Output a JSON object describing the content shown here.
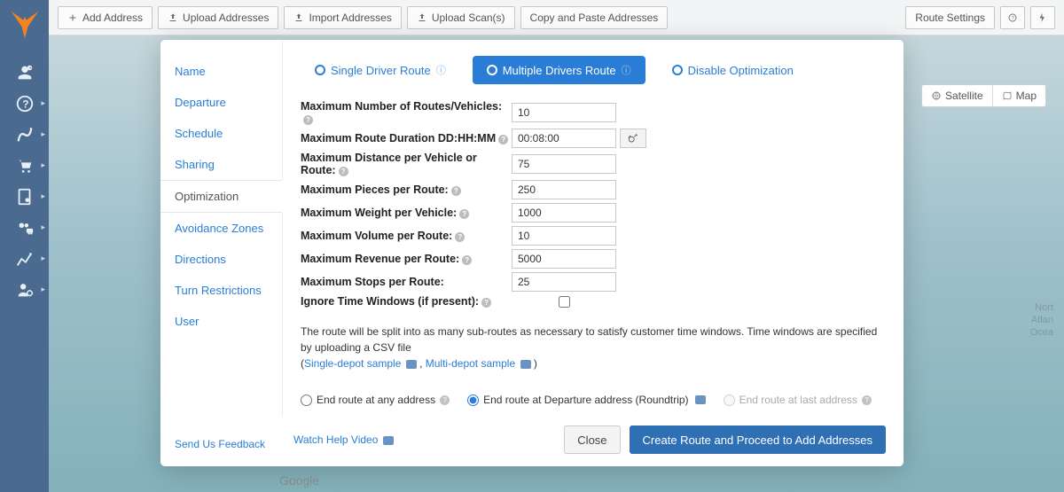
{
  "toolbar": {
    "add_address": "Add Address",
    "upload_addresses": "Upload Addresses",
    "import_addresses": "Import Addresses",
    "upload_scans": "Upload Scan(s)",
    "copy_paste": "Copy and Paste Addresses",
    "route_settings": "Route Settings"
  },
  "map": {
    "satellite": "Satellite",
    "map": "Map",
    "ocean_label": "Nort\nAtlan\nOcea",
    "footer": "Google"
  },
  "modal": {
    "left_tabs": [
      "Name",
      "Departure",
      "Schedule",
      "Sharing",
      "Optimization",
      "Avoidance Zones",
      "Directions",
      "Turn Restrictions",
      "User"
    ],
    "active_tab": "Optimization",
    "feedback": "Send Us Feedback",
    "help_video": "Watch Help Video",
    "route_types": {
      "single": "Single Driver Route",
      "multiple": "Multiple Drivers Route",
      "disable": "Disable Optimization"
    },
    "fields": {
      "max_routes": {
        "label": "Maximum Number of Routes/Vehicles:",
        "value": "10",
        "help": true
      },
      "max_duration": {
        "label": "Maximum Route Duration DD:HH:MM",
        "value": "00:08:00",
        "help": true
      },
      "max_distance": {
        "label": "Maximum Distance per Vehicle or Route:",
        "value": "75",
        "help": true
      },
      "max_pieces": {
        "label": "Maximum Pieces per Route:",
        "value": "250",
        "help": true
      },
      "max_weight": {
        "label": "Maximum Weight per Vehicle:",
        "value": "1000",
        "help": true
      },
      "max_volume": {
        "label": "Maximum Volume per Route:",
        "value": "10",
        "help": true
      },
      "max_revenue": {
        "label": "Maximum Revenue per Route:",
        "value": "5000",
        "help": true
      },
      "max_stops": {
        "label": "Maximum Stops per Route:",
        "value": "25",
        "help": false
      },
      "ignore_tw": {
        "label": "Ignore Time Windows (if present):",
        "help": true
      }
    },
    "info_text": "The route will be split into as many sub-routes as necessary to satisfy customer time windows. Time windows are specified by uploading a CSV file",
    "sample_single": "Single-depot sample",
    "sample_multi": "Multi-depot sample",
    "end_options": {
      "any": "End route at any address",
      "departure": "End route at Departure address (Roundtrip)",
      "last": "End route at last address"
    },
    "footer": {
      "close": "Close",
      "create": "Create Route and Proceed to Add Addresses"
    }
  }
}
